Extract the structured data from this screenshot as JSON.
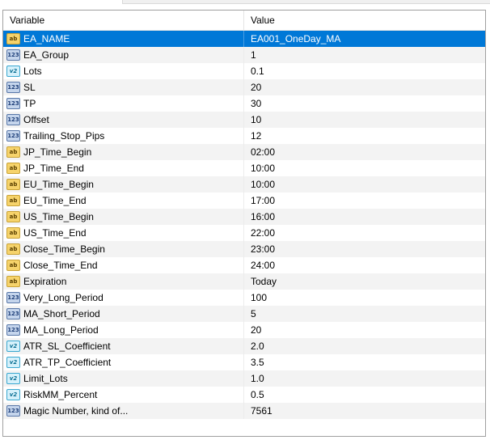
{
  "header": {
    "variable": "Variable",
    "value": "Value"
  },
  "rows": [
    {
      "name": "EA_NAME",
      "value": "EA001_OneDay_MA",
      "type": "string",
      "icon": "ab"
    },
    {
      "name": "EA_Group",
      "value": "1",
      "type": "int",
      "icon": "123"
    },
    {
      "name": "Lots",
      "value": "0.1",
      "type": "double",
      "icon": "v2"
    },
    {
      "name": "SL",
      "value": "20",
      "type": "int",
      "icon": "123"
    },
    {
      "name": "TP",
      "value": "30",
      "type": "int",
      "icon": "123"
    },
    {
      "name": "Offset",
      "value": "10",
      "type": "int",
      "icon": "123"
    },
    {
      "name": "Trailing_Stop_Pips",
      "value": "12",
      "type": "int",
      "icon": "123"
    },
    {
      "name": "JP_Time_Begin",
      "value": "02:00",
      "type": "string",
      "icon": "ab"
    },
    {
      "name": "JP_Time_End",
      "value": "10:00",
      "type": "string",
      "icon": "ab"
    },
    {
      "name": "EU_Time_Begin",
      "value": "10:00",
      "type": "string",
      "icon": "ab"
    },
    {
      "name": "EU_Time_End",
      "value": "17:00",
      "type": "string",
      "icon": "ab"
    },
    {
      "name": "US_Time_Begin",
      "value": "16:00",
      "type": "string",
      "icon": "ab"
    },
    {
      "name": "US_Time_End",
      "value": "22:00",
      "type": "string",
      "icon": "ab"
    },
    {
      "name": "Close_Time_Begin",
      "value": "23:00",
      "type": "string",
      "icon": "ab"
    },
    {
      "name": "Close_Time_End",
      "value": "24:00",
      "type": "string",
      "icon": "ab"
    },
    {
      "name": "Expiration",
      "value": "Today",
      "type": "string",
      "icon": "ab"
    },
    {
      "name": "Very_Long_Period",
      "value": "100",
      "type": "int",
      "icon": "123"
    },
    {
      "name": "MA_Short_Period",
      "value": "5",
      "type": "int",
      "icon": "123"
    },
    {
      "name": "MA_Long_Period",
      "value": "20",
      "type": "int",
      "icon": "123"
    },
    {
      "name": "ATR_SL_Coefficient",
      "value": "2.0",
      "type": "double",
      "icon": "v2"
    },
    {
      "name": "ATR_TP_Coefficient",
      "value": "3.5",
      "type": "double",
      "icon": "v2"
    },
    {
      "name": "Limit_Lots",
      "value": "1.0",
      "type": "double",
      "icon": "v2"
    },
    {
      "name": "RiskMM_Percent",
      "value": "0.5",
      "type": "double",
      "icon": "v2"
    },
    {
      "name": "Magic Number, kind of...",
      "value": "7561",
      "type": "int",
      "icon": "123"
    }
  ],
  "selected_index": 0,
  "colors": {
    "selection": "#0078d7",
    "alt_row": "#f3f3f3"
  }
}
